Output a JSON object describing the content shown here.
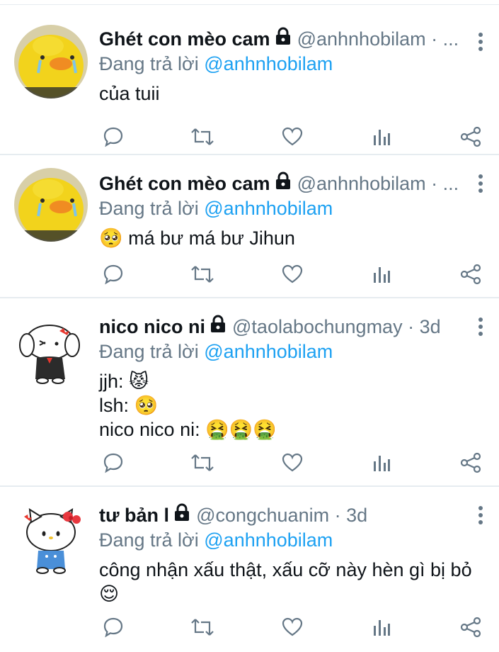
{
  "tweets": [
    {
      "display_name": "Ghét con mèo cam",
      "handle": "@anhnhobilam · ...",
      "reply_prefix": "Đang trả lời ",
      "reply_to": "@anhnhobilam",
      "text_lines": [
        "của tuii"
      ],
      "avatar": "yellow-duckling-crying-avatar"
    },
    {
      "display_name": "Ghét con mèo cam",
      "handle": "@anhnhobilam · ...",
      "reply_prefix": "Đang trả lời ",
      "reply_to": "@anhnhobilam",
      "text_lines": [
        "🥺 má bư má bư Jihun"
      ],
      "avatar": "yellow-duckling-crying-avatar"
    },
    {
      "display_name": "nico nico ni",
      "handle": "@taolabochungmay · 3d",
      "reply_prefix": "Đang trả lời ",
      "reply_to": "@anhnhobilam",
      "text_lines": [
        "jjh: 😾",
        "lsh: 🥺",
        "nico nico ni: 🤮🤮🤮"
      ],
      "avatar": "white-dog-angry-avatar"
    },
    {
      "display_name": "tư bản l",
      "handle": "@congchuanim · 3d",
      "reply_prefix": "Đang trả lời ",
      "reply_to": "@anhnhobilam",
      "text_lines": [
        "công nhận xấu thật, xấu cỡ này hèn gì bị bỏ",
        "😌"
      ],
      "avatar": "hello-kitty-angry-avatar"
    }
  ],
  "icons": {
    "reply": "speech-bubble-icon",
    "retweet": "retweet-icon",
    "like": "heart-icon",
    "analytics": "bar-chart-icon",
    "share": "share-icon",
    "lock": "lock-icon",
    "more": "vertical-dots-icon"
  },
  "colors": {
    "text": "#0f1419",
    "secondary": "#657786",
    "mention": "#1da1f2",
    "divider": "#e6ecf0"
  }
}
